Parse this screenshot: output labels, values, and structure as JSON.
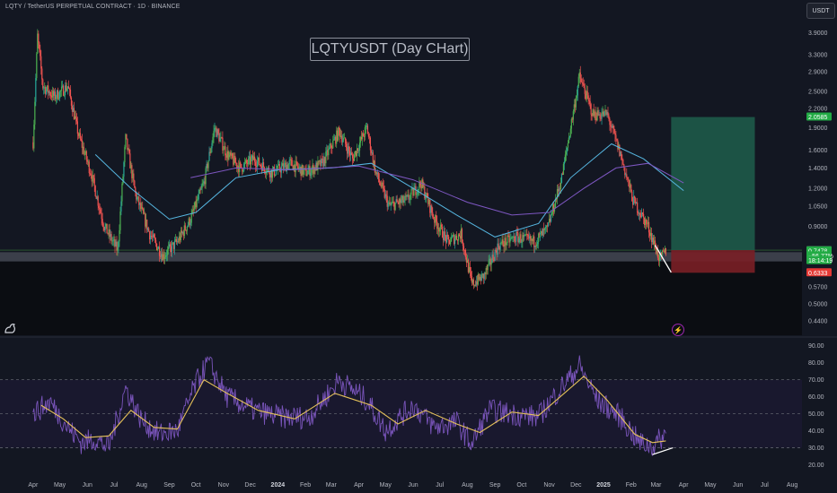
{
  "header": {
    "symbol_info": "LQTY / TetherUS PERPETUAL CONTRACT · 1D · BINANCE",
    "chart_title": "LQTYUSDT (Day CHart)",
    "unit_button": "USDT"
  },
  "colors": {
    "background": "#131722",
    "up_candle": "#26a69a",
    "up_candle_alt": "#4caf50",
    "down_candle": "#ef5350",
    "ma_fast": "#56b6e0",
    "ma_slow": "#7e57c2",
    "rsi_line": "#7e57c2",
    "rsi_ma": "#e6c25a",
    "target_zone": "#1f5e4b",
    "stop_zone": "#7a1f26",
    "support_band": "#5d606b",
    "target_label": "#22ab45",
    "stop_label": "#e53935",
    "current_label": "#22ab45"
  },
  "chart_data": [
    {
      "type": "candlestick",
      "title": "LQTYUSDT (Day CHart)",
      "y_scale": "log",
      "y_ticks": [
        0.44,
        0.5,
        0.57,
        0.74,
        0.9,
        1.05,
        1.2,
        1.4,
        1.6,
        1.9,
        2.2,
        2.5,
        2.9,
        3.3,
        3.9
      ],
      "y_tick_labels": [
        "0.4400",
        "0.5000",
        "0.5700",
        "",
        "0.9000",
        "1.0500",
        "1.2000",
        "1.4000",
        "1.6000",
        "1.9000",
        "2.2000",
        "2.5000",
        "2.9000",
        "3.3000",
        "3.9000"
      ],
      "ylim": [
        0.4,
        4.3
      ],
      "x_ticks": [
        "Apr",
        "May",
        "Jun",
        "Jul",
        "Aug",
        "Sep",
        "Oct",
        "Nov",
        "Dec",
        "2024",
        "Feb",
        "Mar",
        "Apr",
        "May",
        "Jun",
        "Jul",
        "Aug",
        "Sep",
        "Oct",
        "Nov",
        "Dec",
        "2025",
        "Feb",
        "Mar",
        "Apr",
        "May",
        "Jun",
        "Jul",
        "Aug"
      ],
      "close_path": [
        {
          "x": "2023-04-01",
          "y": 1.7
        },
        {
          "x": "2023-04-06",
          "y": 3.8
        },
        {
          "x": "2023-04-12",
          "y": 2.6
        },
        {
          "x": "2023-04-25",
          "y": 2.4
        },
        {
          "x": "2023-05-10",
          "y": 2.6
        },
        {
          "x": "2023-05-22",
          "y": 1.8
        },
        {
          "x": "2023-06-05",
          "y": 1.35
        },
        {
          "x": "2023-06-20",
          "y": 0.9
        },
        {
          "x": "2023-07-05",
          "y": 0.75
        },
        {
          "x": "2023-07-14",
          "y": 1.75
        },
        {
          "x": "2023-07-25",
          "y": 1.15
        },
        {
          "x": "2023-08-10",
          "y": 0.85
        },
        {
          "x": "2023-08-25",
          "y": 0.72
        },
        {
          "x": "2023-09-10",
          "y": 0.8
        },
        {
          "x": "2023-09-25",
          "y": 0.95
        },
        {
          "x": "2023-10-10",
          "y": 1.25
        },
        {
          "x": "2023-10-22",
          "y": 1.9
        },
        {
          "x": "2023-11-05",
          "y": 1.55
        },
        {
          "x": "2023-11-20",
          "y": 1.4
        },
        {
          "x": "2023-12-05",
          "y": 1.5
        },
        {
          "x": "2023-12-25",
          "y": 1.35
        },
        {
          "x": "2024-01-15",
          "y": 1.45
        },
        {
          "x": "2024-02-01",
          "y": 1.35
        },
        {
          "x": "2024-02-20",
          "y": 1.45
        },
        {
          "x": "2024-03-10",
          "y": 1.85
        },
        {
          "x": "2024-03-25",
          "y": 1.5
        },
        {
          "x": "2024-04-10",
          "y": 1.9
        },
        {
          "x": "2024-04-20",
          "y": 1.35
        },
        {
          "x": "2024-05-05",
          "y": 1.05
        },
        {
          "x": "2024-05-25",
          "y": 1.1
        },
        {
          "x": "2024-06-10",
          "y": 1.25
        },
        {
          "x": "2024-06-25",
          "y": 0.95
        },
        {
          "x": "2024-07-10",
          "y": 0.8
        },
        {
          "x": "2024-07-25",
          "y": 0.85
        },
        {
          "x": "2024-08-06",
          "y": 0.58
        },
        {
          "x": "2024-08-20",
          "y": 0.62
        },
        {
          "x": "2024-09-05",
          "y": 0.78
        },
        {
          "x": "2024-09-25",
          "y": 0.83
        },
        {
          "x": "2024-10-15",
          "y": 0.8
        },
        {
          "x": "2024-10-30",
          "y": 0.88
        },
        {
          "x": "2024-11-15",
          "y": 1.3
        },
        {
          "x": "2024-12-05",
          "y": 2.8
        },
        {
          "x": "2024-12-20",
          "y": 2.1
        },
        {
          "x": "2025-01-05",
          "y": 2.1
        },
        {
          "x": "2025-01-20",
          "y": 1.55
        },
        {
          "x": "2025-02-03",
          "y": 1.1
        },
        {
          "x": "2025-02-20",
          "y": 0.9
        },
        {
          "x": "2025-03-05",
          "y": 0.7
        },
        {
          "x": "2025-03-12",
          "y": 0.7478
        }
      ],
      "moving_averages": [
        {
          "name": "",
          "values": [
            {
              "x": "2023-06-10",
              "y": 1.55
            },
            {
              "x": "2023-07-20",
              "y": 1.2
            },
            {
              "x": "2023-09-01",
              "y": 0.95
            },
            {
              "x": "2023-10-01",
              "y": 1.0
            },
            {
              "x": "2023-11-15",
              "y": 1.3
            },
            {
              "x": "2024-01-01",
              "y": 1.38
            },
            {
              "x": "2024-03-01",
              "y": 1.4
            },
            {
              "x": "2024-04-15",
              "y": 1.45
            },
            {
              "x": "2024-06-01",
              "y": 1.2
            },
            {
              "x": "2024-07-20",
              "y": 0.98
            },
            {
              "x": "2024-09-01",
              "y": 0.83
            },
            {
              "x": "2024-10-20",
              "y": 0.92
            },
            {
              "x": "2024-11-25",
              "y": 1.3
            },
            {
              "x": "2025-01-10",
              "y": 1.68
            },
            {
              "x": "2025-02-15",
              "y": 1.5
            },
            {
              "x": "2025-04-01",
              "y": 1.18
            }
          ]
        },
        {
          "name": "",
          "values": [
            {
              "x": "2023-09-25",
              "y": 1.3
            },
            {
              "x": "2023-11-15",
              "y": 1.4
            },
            {
              "x": "2024-01-15",
              "y": 1.38
            },
            {
              "x": "2024-04-01",
              "y": 1.42
            },
            {
              "x": "2024-06-01",
              "y": 1.28
            },
            {
              "x": "2024-08-01",
              "y": 1.08
            },
            {
              "x": "2024-09-20",
              "y": 0.98
            },
            {
              "x": "2024-11-01",
              "y": 1.0
            },
            {
              "x": "2024-12-10",
              "y": 1.2
            },
            {
              "x": "2025-01-15",
              "y": 1.4
            },
            {
              "x": "2025-02-20",
              "y": 1.45
            },
            {
              "x": "2025-04-01",
              "y": 1.25
            }
          ]
        }
      ],
      "position": {
        "entry": 0.7516,
        "target": 2.0585,
        "stop": 0.6333,
        "start": "2025-03-18",
        "end": "2025-06-20"
      },
      "support_zone": [
        0.69,
        0.74
      ],
      "trendline": [
        {
          "x": "2025-02-28",
          "y": 0.78
        },
        {
          "x": "2025-03-18",
          "y": 0.635
        }
      ],
      "price_labels": [
        {
          "text": "2.0585",
          "value": 2.0585,
          "role": "target"
        },
        {
          "text": "0.7516",
          "value": 0.7516,
          "role": "entry"
        },
        {
          "text": "0.7478",
          "value": 0.7478,
          "role": "current"
        },
        {
          "text": "−56.77%",
          "value": 0.72,
          "role": "current"
        },
        {
          "text": "18:14:19",
          "value": 0.695,
          "role": "current"
        },
        {
          "text": "0.6333",
          "value": 0.6333,
          "role": "stop"
        }
      ]
    },
    {
      "type": "line",
      "y_ticks": [
        20,
        30,
        40,
        50,
        60,
        70,
        80,
        90
      ],
      "y_tick_labels": [
        "20.00",
        "30.00",
        "40.00",
        "50.00",
        "60.00",
        "70.00",
        "80.00",
        "90.00"
      ],
      "ylim": [
        15,
        93
      ],
      "reference_levels": [
        30,
        50,
        70
      ],
      "series": [
        {
          "name": "",
          "values": [
            {
              "x": "2023-04-01",
              "y": 50
            },
            {
              "x": "2023-04-20",
              "y": 57
            },
            {
              "x": "2023-05-10",
              "y": 42
            },
            {
              "x": "2023-05-25",
              "y": 33
            },
            {
              "x": "2023-06-10",
              "y": 35
            },
            {
              "x": "2023-06-25",
              "y": 30
            },
            {
              "x": "2023-07-14",
              "y": 65
            },
            {
              "x": "2023-08-01",
              "y": 46
            },
            {
              "x": "2023-08-20",
              "y": 38
            },
            {
              "x": "2023-09-10",
              "y": 40
            },
            {
              "x": "2023-10-01",
              "y": 68
            },
            {
              "x": "2023-10-15",
              "y": 80
            },
            {
              "x": "2023-11-05",
              "y": 60
            },
            {
              "x": "2023-12-05",
              "y": 52
            },
            {
              "x": "2024-01-05",
              "y": 48
            },
            {
              "x": "2024-02-05",
              "y": 48
            },
            {
              "x": "2024-03-10",
              "y": 70
            },
            {
              "x": "2024-04-10",
              "y": 58
            },
            {
              "x": "2024-05-01",
              "y": 40
            },
            {
              "x": "2024-06-01",
              "y": 55
            },
            {
              "x": "2024-06-25",
              "y": 42
            },
            {
              "x": "2024-07-20",
              "y": 45
            },
            {
              "x": "2024-08-06",
              "y": 32
            },
            {
              "x": "2024-08-25",
              "y": 52
            },
            {
              "x": "2024-09-20",
              "y": 50
            },
            {
              "x": "2024-10-20",
              "y": 48
            },
            {
              "x": "2024-11-15",
              "y": 66
            },
            {
              "x": "2024-12-05",
              "y": 78
            },
            {
              "x": "2024-12-25",
              "y": 58
            },
            {
              "x": "2025-01-20",
              "y": 48
            },
            {
              "x": "2025-02-10",
              "y": 33
            },
            {
              "x": "2025-02-25",
              "y": 31
            },
            {
              "x": "2025-03-12",
              "y": 38
            }
          ]
        },
        {
          "name": "",
          "values": [
            {
              "x": "2023-04-10",
              "y": 55
            },
            {
              "x": "2023-05-05",
              "y": 47
            },
            {
              "x": "2023-05-30",
              "y": 36
            },
            {
              "x": "2023-06-25",
              "y": 37
            },
            {
              "x": "2023-07-20",
              "y": 52
            },
            {
              "x": "2023-08-15",
              "y": 42
            },
            {
              "x": "2023-09-10",
              "y": 41
            },
            {
              "x": "2023-10-10",
              "y": 70
            },
            {
              "x": "2023-11-05",
              "y": 62
            },
            {
              "x": "2023-12-10",
              "y": 52
            },
            {
              "x": "2024-01-20",
              "y": 47
            },
            {
              "x": "2024-03-05",
              "y": 62
            },
            {
              "x": "2024-04-15",
              "y": 55
            },
            {
              "x": "2024-05-15",
              "y": 44
            },
            {
              "x": "2024-06-15",
              "y": 52
            },
            {
              "x": "2024-07-20",
              "y": 44
            },
            {
              "x": "2024-08-15",
              "y": 39
            },
            {
              "x": "2024-09-20",
              "y": 51
            },
            {
              "x": "2024-10-20",
              "y": 49
            },
            {
              "x": "2024-11-20",
              "y": 63
            },
            {
              "x": "2024-12-10",
              "y": 72
            },
            {
              "x": "2025-01-05",
              "y": 58
            },
            {
              "x": "2025-02-05",
              "y": 38
            },
            {
              "x": "2025-02-25",
              "y": 33
            },
            {
              "x": "2025-03-12",
              "y": 34
            }
          ]
        }
      ],
      "trendline": [
        {
          "x": "2025-02-25",
          "y": 26
        },
        {
          "x": "2025-03-20",
          "y": 30
        }
      ]
    }
  ]
}
